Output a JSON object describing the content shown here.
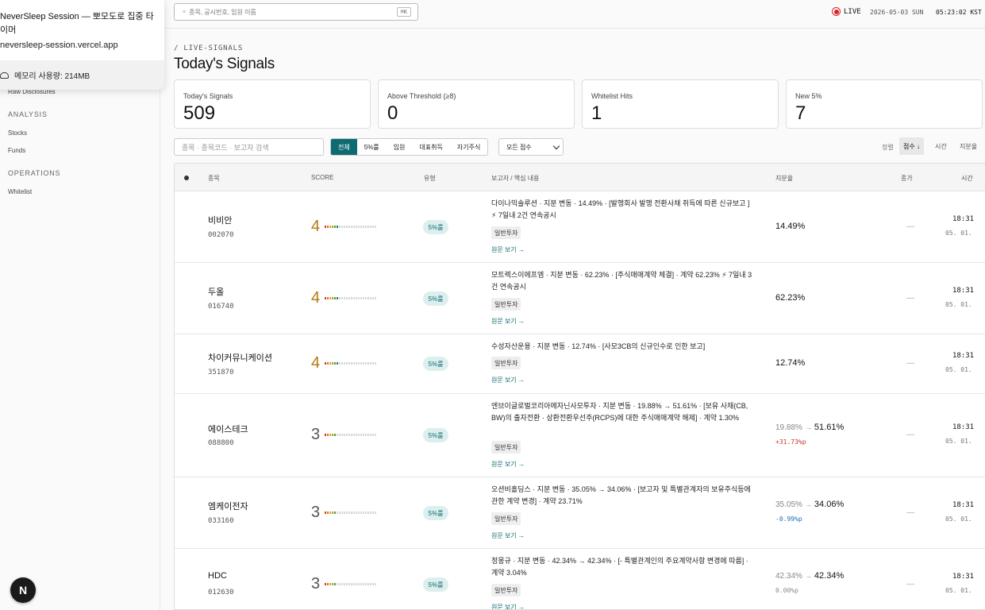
{
  "popup": {
    "title": "NeverSleep Session — 뽀모도로 집중 타이머",
    "url": "neversleep-session.vercel.app",
    "memory": "메모리 사용량: 214MB"
  },
  "sidebar": {
    "raw_disclosures": "Raw Disclosures",
    "analysis_head": "ANALYSIS",
    "stocks": "Stocks",
    "funds": "Funds",
    "operations_head": "OPERATIONS",
    "whitelist": "Whitelist",
    "logo": "N"
  },
  "topbar": {
    "search_placeholder": "종목, 공시번호, 임원 이름",
    "search_shortcut": "⌘K",
    "live": "LIVE",
    "date": "2026-05-03 SUN",
    "clock": "05:23:02 KST"
  },
  "header": {
    "breadcrumb": "/ LIVE-SIGNALS",
    "title": "Today's Signals"
  },
  "stats": [
    {
      "label": "Today's Signals",
      "value": "509"
    },
    {
      "label": "Above Threshold (≥8)",
      "value": "0"
    },
    {
      "label": "Whitelist Hits",
      "value": "1"
    },
    {
      "label": "New 5%",
      "value": "7"
    }
  ],
  "filters": {
    "search_placeholder": "종목 · 종목코드 · 보고자 검색",
    "tabs": [
      "전체",
      "5%룰",
      "임원",
      "대표취득",
      "자기주식"
    ],
    "score_select": "모든 점수",
    "sort_label": "정렬",
    "sort_options": [
      "점수 ↓",
      "시간",
      "지분율"
    ]
  },
  "table": {
    "headers": {
      "name": "종목",
      "score": "SCORE",
      "type": "유형",
      "reporter": "보고자 / 핵심 내용",
      "share": "지분율",
      "close": "종가",
      "time": "시간"
    },
    "rows": [
      {
        "name": "비비안",
        "code": "002070",
        "score": "4",
        "score_level": 4,
        "type": "5%룰",
        "desc": "다이나믹솔루션 · 지분 변동 · 14.49% · [발행회사 발행 전환사채 취득에 따른 신규보고 ] ⚡ 7일내 2건 연속공시",
        "tag": "일반투자",
        "link": "원문 보기 →",
        "share_from": "",
        "share_to": "14.49%",
        "delta": "",
        "close": "—",
        "time": "18:31",
        "date": "05. 01."
      },
      {
        "name": "두올",
        "code": "016740",
        "score": "4",
        "score_level": 4,
        "type": "5%룰",
        "desc": "모트렉스이에프엠 · 지분 변동 · 62.23% · [주식매매계약 체결] · 계약 62.23% ⚡ 7일내 3건 연속공시",
        "tag": "일반투자",
        "link": "원문 보기 →",
        "share_from": "",
        "share_to": "62.23%",
        "delta": "",
        "close": "—",
        "time": "18:31",
        "date": "05. 01."
      },
      {
        "name": "차이커뮤니케이션",
        "code": "351870",
        "score": "4",
        "score_level": 4,
        "type": "5%룰",
        "desc": "수성자산운용 · 지분 변동 · 12.74% · [사모3CB의 신규인수로 인한 보고]",
        "tag": "일반투자",
        "link": "원문 보기 →",
        "share_from": "",
        "share_to": "12.74%",
        "delta": "",
        "close": "—",
        "time": "18:31",
        "date": "05. 01."
      },
      {
        "name": "에이스테크",
        "code": "088800",
        "score": "3",
        "score_level": 3,
        "type": "5%룰",
        "desc": "엔브이글로벌코리아메자닌사모투자 · 지분 변동 · 19.88% → 51.61% · [보유 사채(CB, BW)의 출자전환 · 상환전환우선주(RCPS)에 대한 주식매매계약 해제] · 계약 1.30%",
        "tag": "일반투자",
        "link": "원문 보기 →",
        "share_from": "19.88%",
        "share_to": "51.61%",
        "delta": "+31.73%p",
        "close": "—",
        "time": "18:31",
        "date": "05. 01."
      },
      {
        "name": "엠케이전자",
        "code": "033160",
        "score": "3",
        "score_level": 3,
        "type": "5%룰",
        "desc": "오션비홀딩스 · 지분 변동 · 35.05% → 34.06% · [보고자 및 특별관계자의 보유주식등에 관한 계약 변경] · 계약 23.71%",
        "tag": "일반투자",
        "link": "원문 보기 →",
        "share_from": "35.05%",
        "share_to": "34.06%",
        "delta": "-0.99%p",
        "close": "—",
        "time": "18:31",
        "date": "05. 01."
      },
      {
        "name": "HDC",
        "code": "012630",
        "score": "3",
        "score_level": 3,
        "type": "5%룰",
        "desc": "정몽규 · 지분 변동 · 42.34% → 42.34% · [- 특별관계인의 주요계약사항 변경에 따름] · 계약 3.04%",
        "tag": "일반투자",
        "link": "원문 보기 →",
        "share_from": "42.34%",
        "share_to": "42.34%",
        "delta": "0.00%p",
        "close": "—",
        "time": "18:31",
        "date": "05. 01."
      }
    ]
  },
  "colors": {
    "accent": "#0e6b72",
    "score4": "#b5790d",
    "score3": "#555555",
    "positive": "#d03030",
    "negative": "#1f6fbf",
    "neutral": "#888888",
    "live": "#dd2222"
  }
}
